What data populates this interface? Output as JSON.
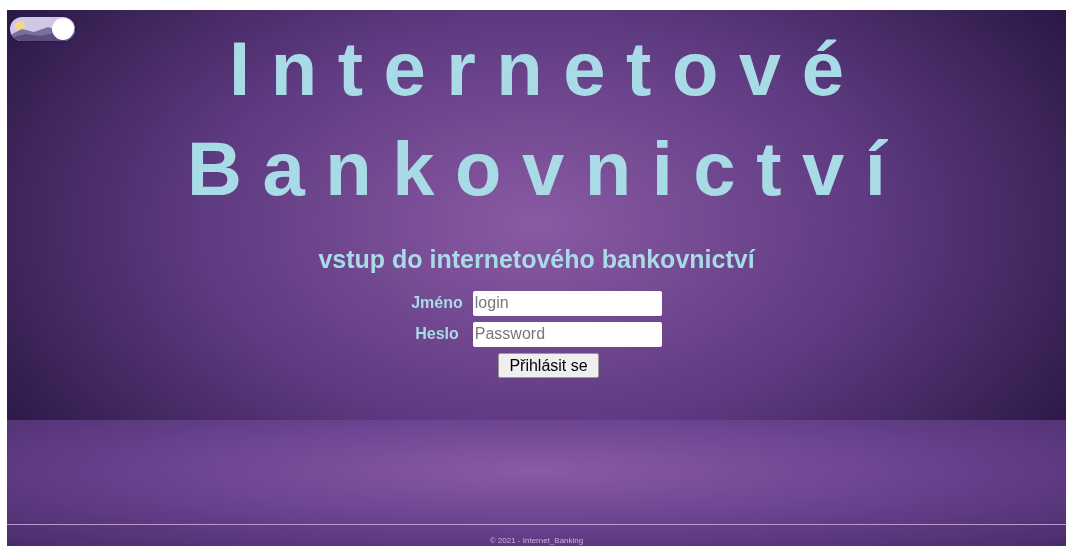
{
  "theme_toggle": {
    "on": true
  },
  "title_lines": [
    "Internetové",
    "Bankovnictví"
  ],
  "subtitle": "vstup do internetového bankovnictví",
  "form": {
    "fields": [
      {
        "label": "Jméno",
        "placeholder": "login"
      },
      {
        "label": "Heslo",
        "placeholder": "Password"
      }
    ],
    "submit": "Přihlásit se"
  },
  "footer": "© 2021 - Internet_Banking"
}
